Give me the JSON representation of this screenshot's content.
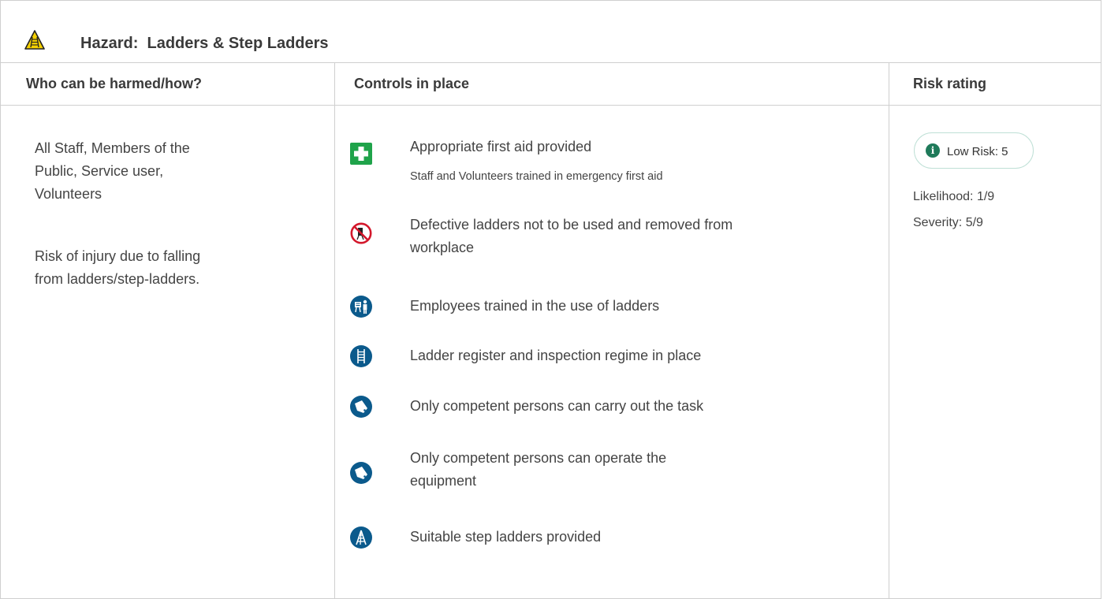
{
  "hazard": {
    "label": "Hazard:",
    "name": "Ladders & Step Ladders",
    "icon": "ladder-warning-icon"
  },
  "columns": {
    "who": "Who can be harmed/how?",
    "controls": "Controls in place",
    "risk": "Risk rating"
  },
  "who": {
    "people_line1": "All Staff, Members of the",
    "people_line2": "Public, Service user,",
    "people_line3": "Volunteers",
    "risk_line1": "Risk of injury due to falling",
    "risk_line2": "from ladders/step-ladders."
  },
  "controls": [
    {
      "icon": "first-aid-icon",
      "title": "Appropriate first aid provided",
      "subtitle": "Staff and Volunteers trained in emergency first aid"
    },
    {
      "icon": "no-defective-ladder-icon",
      "title_line1": "Defective ladders not to be used and removed from",
      "title_line2": "workplace"
    },
    {
      "icon": "training-icon",
      "title": "Employees trained in the use of ladders"
    },
    {
      "icon": "ladder-icon",
      "title": "Ladder register and inspection regime in place"
    },
    {
      "icon": "competent-person-icon",
      "title": "Only competent persons can carry out the task"
    },
    {
      "icon": "competent-person-icon",
      "title_line1": "Only competent persons can operate the",
      "title_line2": "equipment"
    },
    {
      "icon": "step-ladder-icon",
      "title": "Suitable step ladders provided"
    }
  ],
  "risk": {
    "badge": "Low Risk: 5",
    "badge_icon": "info-icon",
    "badge_icon_glyph": "i",
    "likelihood": "Likelihood: 1/9",
    "severity": "Severity: 5/9",
    "color": "#1f7a5a"
  },
  "colors": {
    "icon_blue": "#0b5a8c",
    "first_aid_green": "#1fa34a",
    "prohibition_red": "#d3172b",
    "warning_yellow": "#f5d000"
  }
}
